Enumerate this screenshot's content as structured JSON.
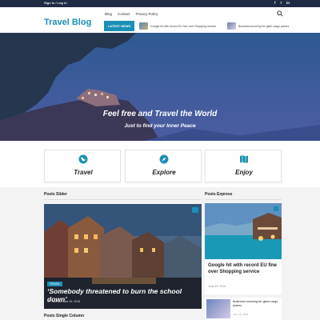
{
  "topbar": {
    "signin": "Sign In / Log In",
    "social": [
      "f",
      "t",
      "in"
    ]
  },
  "header": {
    "logo": "Travel Blog",
    "nav": [
      "Blog",
      "Contact",
      "Privacy Policy"
    ],
    "latest_label": "LATEST NEWS",
    "ticker": [
      "Google hit with record EU fine over Shopping service",
      "Business booming for giant cargo planes"
    ]
  },
  "hero": {
    "title": "Feel free and Travel the World",
    "subtitle": "Just to find your Inner Peace"
  },
  "features": [
    {
      "label": "Travel",
      "icon": "globe-icon"
    },
    {
      "label": "Explore",
      "icon": "compass-icon"
    },
    {
      "label": "Enjoy",
      "icon": "map-icon"
    }
  ],
  "sections": {
    "slider_title": "Posts Slider",
    "express_title": "Posts Express",
    "single_title": "Posts Single Column"
  },
  "slider": {
    "category": "TRAVEL",
    "caption": "‘Somebody threatened to burn the school down’",
    "author": "VP Rannan",
    "date": "June 15, 2018"
  },
  "express": {
    "main_title": "Google hit with record EU fine over Shopping service",
    "main_date": "June 15, 2018",
    "item_title": "Business booming for giant cargo planes",
    "item_date": "June 15, 2018"
  },
  "colors": {
    "accent": "#1b8fb5",
    "topbar": "#1f2a44"
  }
}
